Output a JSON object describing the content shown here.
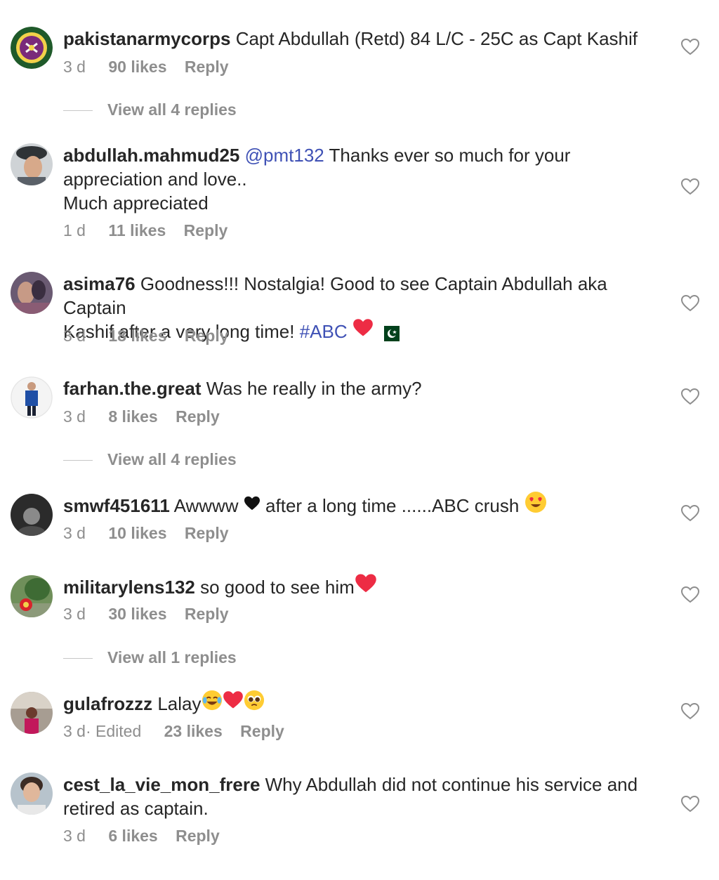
{
  "comments": [
    {
      "username": "pakistanarmycorps",
      "text": "Capt Abdullah (Retd) 84 L/C - 25C as Capt Kashif",
      "time": "3 d",
      "likes": "90 likes",
      "reply": "Reply",
      "view_replies": "View all 4 replies"
    },
    {
      "username": "abdullah.mahmud25",
      "mention": "@pmt132",
      "text_line1": "Thanks ever so much for your",
      "text_line2": "appreciation and love..",
      "text_line3": "Much appreciated",
      "time": "1 d",
      "likes": "11 likes",
      "reply": "Reply"
    },
    {
      "username": "asima76",
      "text_line1": "Goodness!!! Nostalgia! Good to see Captain Abdullah aka Captain",
      "text_line2": "Kashif after a very long time!",
      "hashtag": "#ABC",
      "time": "3 d",
      "likes": "18 likes",
      "reply": "Reply"
    },
    {
      "username": "farhan.the.great",
      "text": "Was he really in the army?",
      "time": "3 d",
      "likes": "8 likes",
      "reply": "Reply",
      "view_replies": "View all 4 replies"
    },
    {
      "username": "smwf451611",
      "text_a": "Awwww",
      "text_b": "after a long time ......ABC crush",
      "time": "3 d",
      "likes": "10 likes",
      "reply": "Reply"
    },
    {
      "username": "militarylens132",
      "text": "so good to see him",
      "time": "3 d",
      "likes": "30 likes",
      "reply": "Reply",
      "view_replies": "View all 1 replies"
    },
    {
      "username": "gulafrozzz",
      "text": "Lalay",
      "time": "3 d· Edited",
      "likes": "23 likes",
      "reply": "Reply"
    },
    {
      "username": "cest_la_vie_mon_frere",
      "text_line1": "Why Abdullah did not continue his service and",
      "text_line2": "retired as captain.",
      "time": "3 d",
      "likes": "6 likes",
      "reply": "Reply"
    }
  ],
  "colors": {
    "text": "#262626",
    "muted": "#8e8e8e",
    "link": "#3f51b5",
    "heart_red": "#ed2c44"
  }
}
